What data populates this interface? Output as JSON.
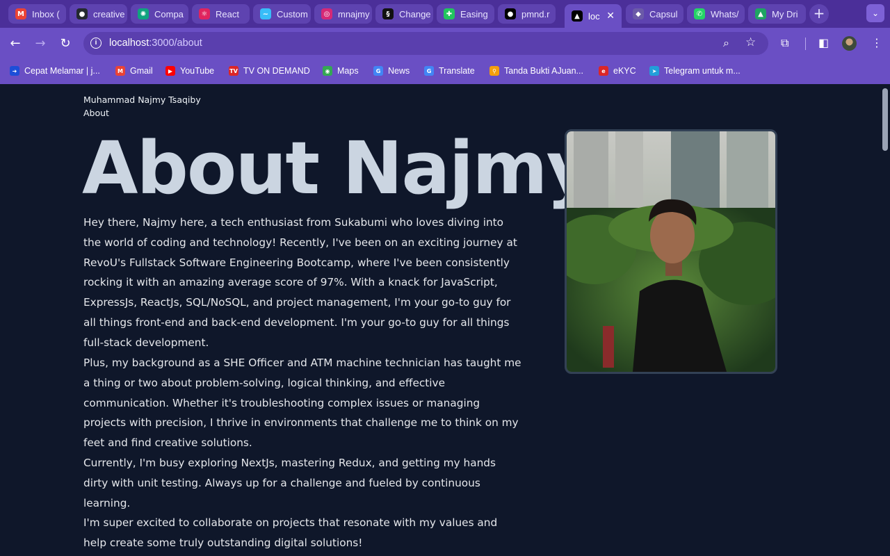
{
  "browser": {
    "tabs": [
      {
        "title": "Inbox (",
        "icon": "gmail-icon",
        "color": "#ea4335",
        "glyph": "M"
      },
      {
        "title": "creative",
        "icon": "github-icon",
        "color": "#24292f",
        "glyph": "●"
      },
      {
        "title": "Compa",
        "icon": "openai-icon",
        "color": "#10a37f",
        "glyph": "✺"
      },
      {
        "title": "React",
        "icon": "react-icon",
        "color": "#e0245e",
        "glyph": "⚛"
      },
      {
        "title": "Custom",
        "icon": "tailwind-icon",
        "color": "#38bdf8",
        "glyph": "~"
      },
      {
        "title": "mnajmy",
        "icon": "instagram-icon",
        "color": "#d62976",
        "glyph": "◎"
      },
      {
        "title": "Change",
        "icon": "squarespace-icon",
        "color": "#111111",
        "glyph": "§"
      },
      {
        "title": "Easing",
        "icon": "easing-icon",
        "color": "#22c55e",
        "glyph": "✚"
      },
      {
        "title": "pmnd.r",
        "icon": "pmndrs-icon",
        "color": "#000000",
        "glyph": "●"
      },
      {
        "title": "loc",
        "icon": "nextjs-icon",
        "color": "#000000",
        "glyph": "▲",
        "active": true
      },
      {
        "title": "Capsul",
        "icon": "capsule-icon",
        "color": "#6b5aa8",
        "glyph": "◆"
      },
      {
        "title": "Whats/",
        "icon": "whatsapp-icon",
        "color": "#25d366",
        "glyph": "✆"
      },
      {
        "title": "My Dri",
        "icon": "google-drive-icon",
        "color": "#1fa463",
        "glyph": "▲"
      }
    ],
    "new_tab": "+",
    "tab_menu": "⌄",
    "url_host": "localhost",
    "url_path": ":3000/about",
    "bookmarks": [
      {
        "label": "Cepat Melamar | j...",
        "icon": "bookmark-cepat-icon",
        "color": "#1d4ed8",
        "glyph": "➜"
      },
      {
        "label": "Gmail",
        "icon": "gmail-icon",
        "color": "#ea4335",
        "glyph": "M"
      },
      {
        "label": "YouTube",
        "icon": "youtube-icon",
        "color": "#ff0000",
        "glyph": "▶"
      },
      {
        "label": "TV ON DEMAND",
        "icon": "tv-icon",
        "color": "#dc2626",
        "glyph": "TV"
      },
      {
        "label": "Maps",
        "icon": "maps-icon",
        "color": "#34a853",
        "glyph": "◉"
      },
      {
        "label": "News",
        "icon": "news-icon",
        "color": "#4285f4",
        "glyph": "G"
      },
      {
        "label": "Translate",
        "icon": "translate-icon",
        "color": "#4285f4",
        "glyph": "G"
      },
      {
        "label": "Tanda Bukti AJuan...",
        "icon": "bookmark-tanda-icon",
        "color": "#f59e0b",
        "glyph": "⚲"
      },
      {
        "label": "eKYC",
        "icon": "ekyc-icon",
        "color": "#dc2626",
        "glyph": "e"
      },
      {
        "label": "Telegram untuk m...",
        "icon": "telegram-icon",
        "color": "#229ed9",
        "glyph": "➤"
      }
    ]
  },
  "site": {
    "brand": "Muhammad Najmy Tsaqiby",
    "nav_about": "About",
    "heading": "About Najmy",
    "paragraphs": [
      "Hey there, Najmy here, a tech enthusiast from Sukabumi who loves diving into the world of coding and technology! Recently, I've been on an exciting journey at RevoU's Fullstack Software Engineering Bootcamp, where I've been consistently rocking it with an amazing average score of 97%. With a knack for JavaScript, ExpressJs, ReactJs, SQL/NoSQL, and project management, I'm your go-to guy for all things front-end and back-end development.  I'm your go-to guy for all things full-stack development.",
      "Plus, my background as a SHE Officer and ATM machine technician has taught me a thing or two about problem-solving, logical thinking, and effective communication. Whether it's troubleshooting complex issues or managing projects with precision, I thrive in environments that challenge me to think on my feet and find creative solutions.",
      "Currently, I'm busy exploring NextJs, mastering Redux, and getting my hands dirty with unit testing. Always up for a challenge and fueled by continuous learning.",
      "I'm super excited to collaborate on projects that resonate with my values and help create some truly outstanding digital solutions!"
    ]
  },
  "colors": {
    "page_bg": "#0f172a",
    "heading": "#cbd5e1",
    "body_text": "#e5e7eb",
    "chrome_bar": "#6a4fc4",
    "tab_strip": "#4b2f99"
  }
}
